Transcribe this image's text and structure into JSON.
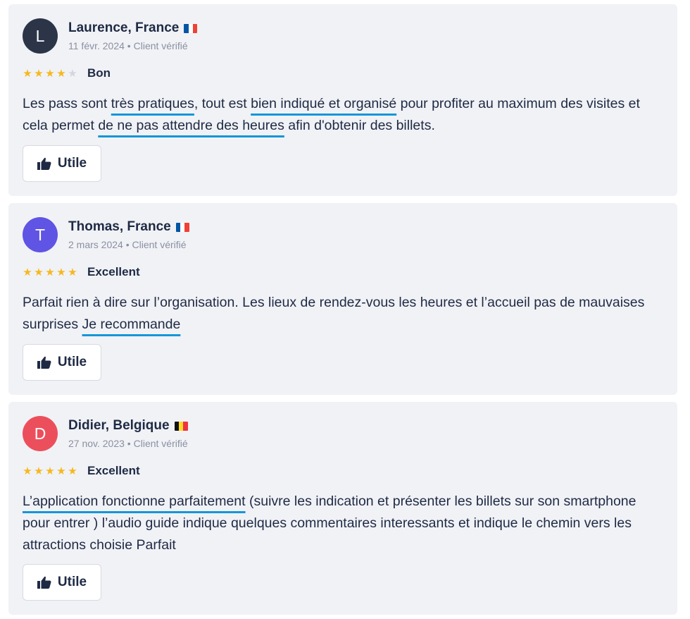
{
  "reviews": [
    {
      "initial": "L",
      "avatar_color": "#2c3548",
      "name": "Laurence, France",
      "flag": [
        "#0055a4",
        "#ffffff",
        "#ef4135"
      ],
      "date": "11 févr. 2024",
      "verified": "Client vérifié",
      "stars": 4,
      "rating_label": "Bon",
      "text": [
        {
          "t": "Les pass sont "
        },
        {
          "t": "très pratiques",
          "h": true
        },
        {
          "t": ", tout est "
        },
        {
          "t": "bien indiqué et organisé",
          "h": true
        },
        {
          "t": " pour profiter au maximum des visites et cela permet "
        },
        {
          "t": "de ne pas attendre des heures",
          "h": true
        },
        {
          "t": " afin d'obtenir des billets."
        }
      ],
      "helpful_label": "Utile"
    },
    {
      "initial": "T",
      "avatar_color": "#6054e4",
      "name": "Thomas, France",
      "flag": [
        "#0055a4",
        "#ffffff",
        "#ef4135"
      ],
      "date": "2 mars 2024",
      "verified": "Client vérifié",
      "stars": 5,
      "rating_label": "Excellent",
      "text": [
        {
          "t": "Parfait rien à dire sur l’organisation. Les lieux de rendez-vous les heures et l’accueil pas de mauvaises surprises "
        },
        {
          "t": "Je recommande",
          "h": true
        }
      ],
      "helpful_label": "Utile"
    },
    {
      "initial": "D",
      "avatar_color": "#ec4f5c",
      "name": "Didier, Belgique",
      "flag": [
        "#111111",
        "#fdda24",
        "#ef3340"
      ],
      "date": "27 nov. 2023",
      "verified": "Client vérifié",
      "stars": 5,
      "rating_label": "Excellent",
      "text": [
        {
          "t": "L’application fonctionne parfaitement",
          "h": true
        },
        {
          "t": " (suivre les indication et présenter les billets sur son smartphone pour entrer ) l’audio guide indique quelques commentaires interessants et indique le chemin vers les attractions choisie Parfait"
        }
      ],
      "helpful_label": "Utile"
    }
  ],
  "colors": {
    "card_bg": "#f1f2f6",
    "star_on": "#f6b81d",
    "star_off": "#d3d6de",
    "highlight": "#1596d8",
    "text": "#1e2a44",
    "meta": "#8a90a2"
  }
}
